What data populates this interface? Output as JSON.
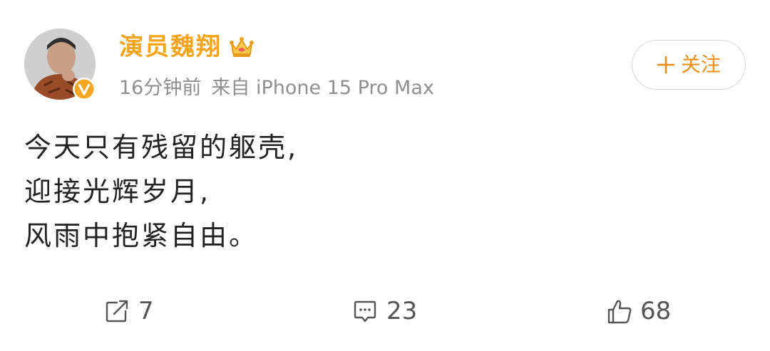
{
  "post": {
    "author": {
      "name": "演员魏翔",
      "avatar_icon": "user-avatar",
      "verified_icon": "verified-badge-icon",
      "vip_icon": "crown-icon"
    },
    "meta": {
      "time": "16分钟前",
      "source": "来自 iPhone 15 Pro Max"
    },
    "follow_button": {
      "icon": "plus-icon",
      "label": "关注"
    },
    "content_lines": [
      "今天只有残留的躯壳,",
      "迎接光辉岁月,",
      "风雨中抱紧自由。"
    ],
    "actions": {
      "repost": {
        "icon": "share-icon",
        "count": "7"
      },
      "comment": {
        "icon": "comment-icon",
        "count": "23"
      },
      "like": {
        "icon": "thumbs-up-icon",
        "count": "68"
      }
    }
  },
  "colors": {
    "author_name": "#f6a419",
    "follow_text": "#e98d1b",
    "meta_text": "#8f8f8f",
    "body_text": "#222222",
    "action_text": "#555555"
  }
}
